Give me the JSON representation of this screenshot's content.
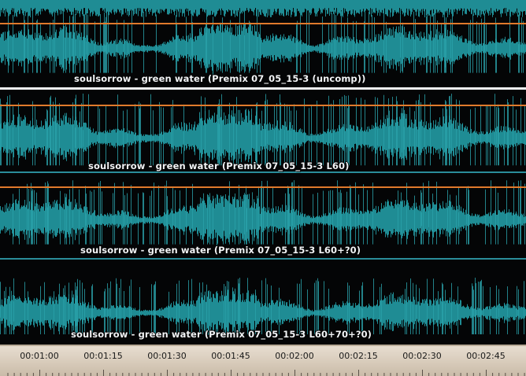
{
  "colors": {
    "background": "#040506",
    "waveform": "#1f8c94",
    "waveform_peak": "#2aa2aa",
    "orange_line": "#e07a2c",
    "blue_line": "#2a8d9a",
    "separator": "#f4f6f8",
    "ruler_bg": "#d8ccbb",
    "ruler_text": "#1a1a1a"
  },
  "tracks": [
    {
      "label": "soulsorrow - green water (Premix 07_05_15-3 (uncomp))"
    },
    {
      "label": "soulsorrow - green water (Premix 07_05_15-3 L60)"
    },
    {
      "label": "soulsorrow - green water (Premix 07_05_15-3 L60+?0)"
    },
    {
      "label": "soulsorrow - green water (Premix 07_05_15-3 L60+70+?0)"
    }
  ],
  "timeline": {
    "labels": [
      "00:01:00",
      "00:01:15",
      "00:01:30",
      "00:01:45",
      "00:02:00",
      "00:02:15",
      "00:02:30",
      "00:02:45"
    ]
  }
}
